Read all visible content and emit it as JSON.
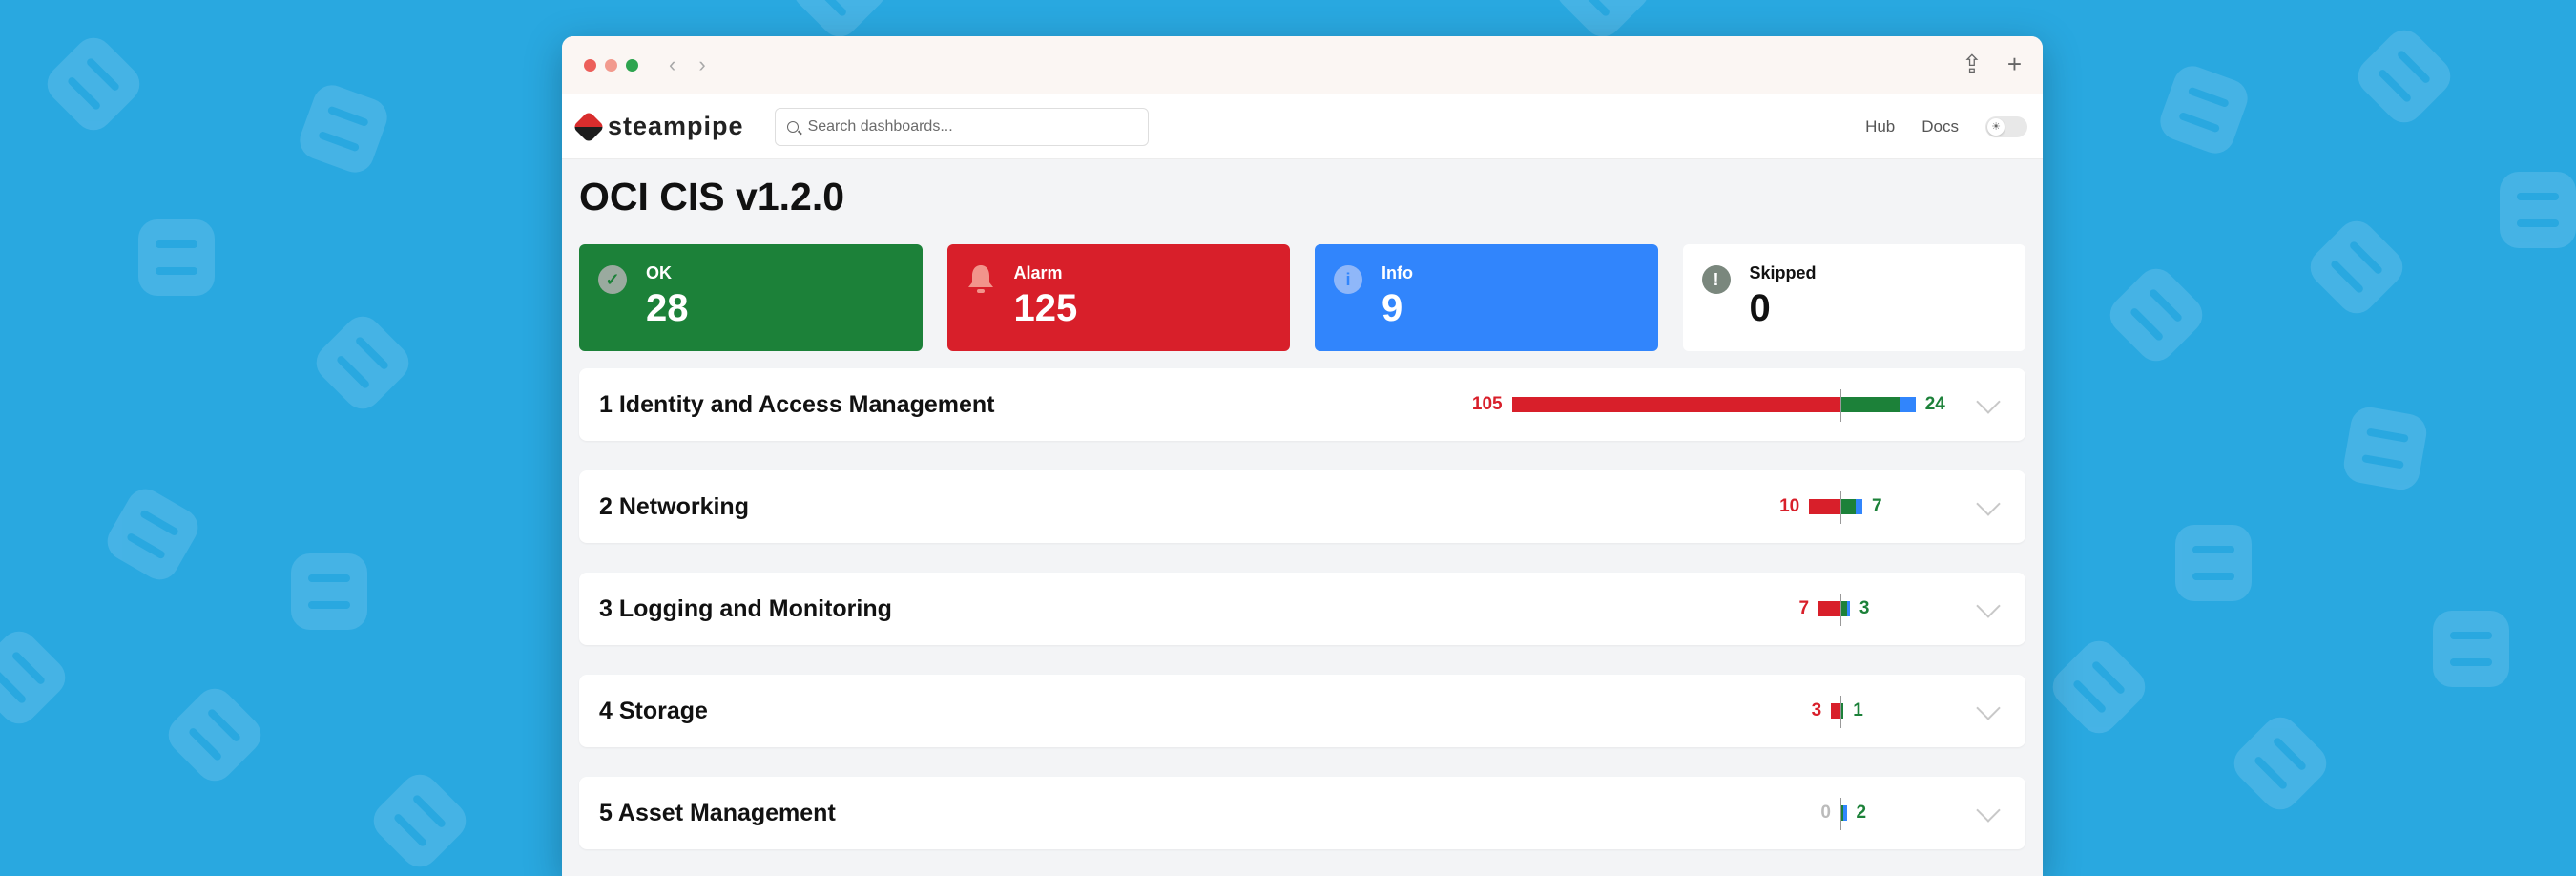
{
  "browser": {
    "traffic_lights": {
      "close": "#ec5f5a",
      "minimize": "#f29a8e",
      "maximize": "#2ea44f"
    },
    "back_icon": "‹",
    "forward_icon": "›",
    "share_icon": "⇪",
    "new_tab_icon": "+"
  },
  "topnav": {
    "logo_text": "steampipe",
    "search_placeholder": "Search dashboards...",
    "links": [
      "Hub",
      "Docs"
    ],
    "theme_toggle_icon": "☀"
  },
  "page": {
    "title": "OCI CIS v1.2.0"
  },
  "summary_cards": [
    {
      "key": "ok",
      "label": "OK",
      "value": "28",
      "icon": "✓",
      "color": "#1c8139"
    },
    {
      "key": "alarm",
      "label": "Alarm",
      "value": "125",
      "icon": "🔔",
      "color": "#d81f2a"
    },
    {
      "key": "info",
      "label": "Info",
      "value": "9",
      "icon": "i",
      "color": "#3185fc"
    },
    {
      "key": "skip",
      "label": "Skipped",
      "value": "0",
      "icon": "!",
      "color": "#ffffff"
    }
  ],
  "sections": [
    {
      "title": "1 Identity and Access Management",
      "alarm": 105,
      "ok": 19,
      "info": 5,
      "left_label": "105",
      "right_label": "24"
    },
    {
      "title": "2 Networking",
      "alarm": 10,
      "ok": 5,
      "info": 2,
      "left_label": "10",
      "right_label": "7"
    },
    {
      "title": "3 Logging and Monitoring",
      "alarm": 7,
      "ok": 2,
      "info": 1,
      "left_label": "7",
      "right_label": "3"
    },
    {
      "title": "4 Storage",
      "alarm": 3,
      "ok": 1,
      "info": 0,
      "left_label": "3",
      "right_label": "1"
    },
    {
      "title": "5 Asset Management",
      "alarm": 0,
      "ok": 1,
      "info": 1,
      "left_label": "0",
      "right_label": "2"
    }
  ]
}
